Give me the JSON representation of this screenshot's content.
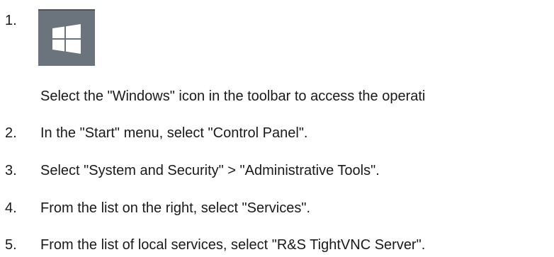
{
  "steps": [
    {
      "number": "1.",
      "text": "Select the \"Windows\" icon in the toolbar to access the operati",
      "icon": "windows-logo-icon"
    },
    {
      "number": "2.",
      "text": "In the \"Start\" menu, select \"Control Panel\"."
    },
    {
      "number": "3.",
      "text": "Select \"System and Security\" > \"Administrative Tools\"."
    },
    {
      "number": "4.",
      "text": "From the list on the right, select \"Services\"."
    },
    {
      "number": "5.",
      "text": "From the list of local services, select \"R&S TightVNC Server\"."
    }
  ],
  "colors": {
    "icon_background": "#6b747c",
    "icon_glyph": "#ffffff",
    "text": "#1a1a1a"
  }
}
